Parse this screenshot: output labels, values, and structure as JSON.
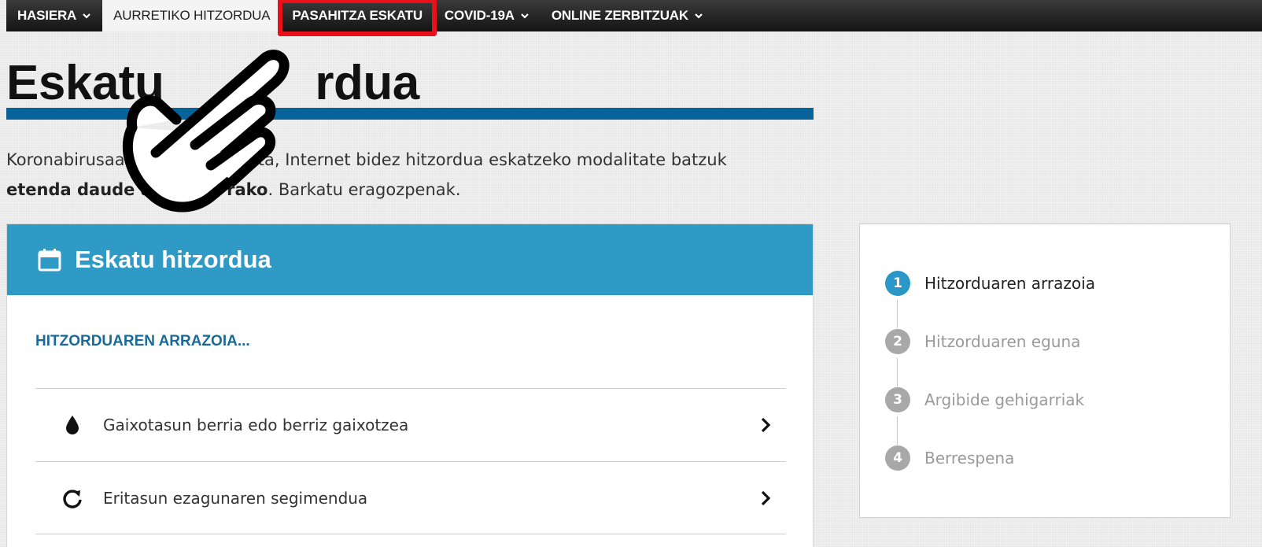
{
  "nav": {
    "items": [
      {
        "label": "HASIERA",
        "has_chevron": true
      },
      {
        "label": "AURRETIKO HITZORDUA",
        "has_chevron": false,
        "active": true
      },
      {
        "label": "PASAHITZA ESKATU",
        "has_chevron": false,
        "highlighted": true
      },
      {
        "label": "COVID-19A",
        "has_chevron": true
      },
      {
        "label": "ONLINE ZERBITZUAK",
        "has_chevron": true
      }
    ]
  },
  "page": {
    "title_left": "Eskatu",
    "title_right": "rdua",
    "intro_line1": "Koronabirusaa",
    "intro_line1_rest": "ela eta, Internet bidez hitzordua eskatzeko modalitate batzuk",
    "intro_bold": "etenda daude al",
    "intro_bold_rest": "rako",
    "intro_end": ". Barkatu eragozpenak."
  },
  "card": {
    "header_icon": "calendar-icon",
    "title": "Eskatu hitzordua",
    "section_label": "HITZORDUAREN ARRAZOIA...",
    "reasons": [
      {
        "icon": "drop-icon",
        "label": "Gaixotasun berria edo berriz gaixotzea"
      },
      {
        "icon": "refresh-icon",
        "label": "Eritasun ezagunaren segimendua"
      }
    ]
  },
  "stepper": {
    "steps": [
      {
        "num": "1",
        "label": "Hitzorduaren arrazoia",
        "current": true
      },
      {
        "num": "2",
        "label": "Hitzorduaren eguna"
      },
      {
        "num": "3",
        "label": "Argibide gehigarriak"
      },
      {
        "num": "4",
        "label": "Berrespena"
      }
    ]
  },
  "colors": {
    "nav_bg": "#1e1e1e",
    "highlight_box": "#e8101a",
    "title_bar": "#06649a",
    "card_header": "#2e9ac5",
    "section_label": "#1a6a98",
    "step_current": "#2a97c7",
    "step_inactive": "#a8a8a8"
  },
  "overlay": {
    "icon": "pointing-hand-icon"
  }
}
